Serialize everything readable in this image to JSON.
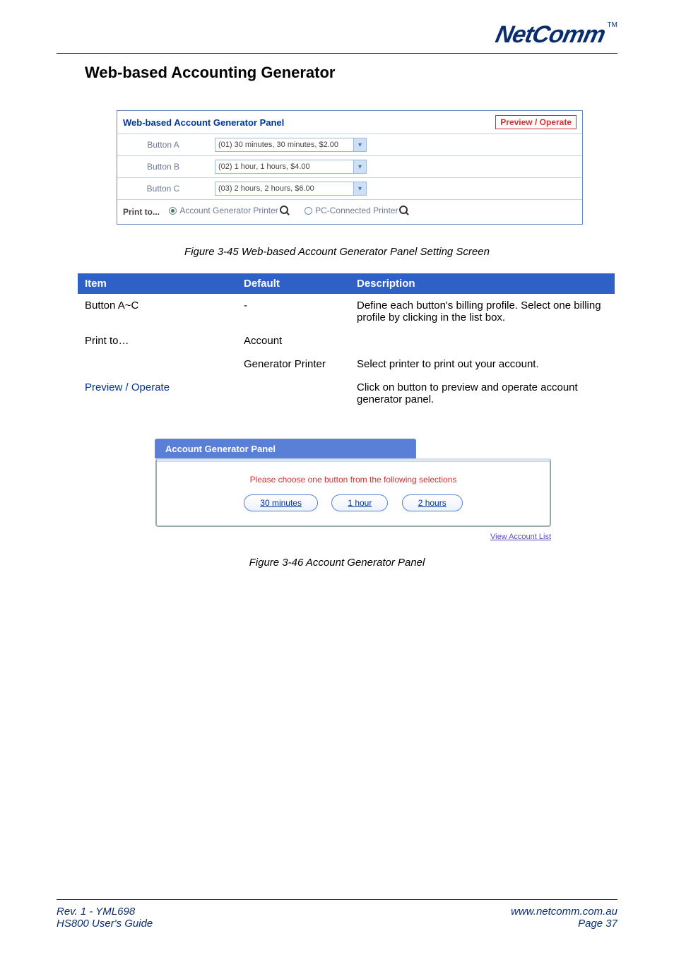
{
  "brand": {
    "name": "NetComm",
    "tm": "TM"
  },
  "title": "Web-based Accounting Generator",
  "ill1": {
    "title": "Web-based Account Generator Panel",
    "preview_btn": "Preview / Operate",
    "rows": [
      {
        "label": "Button A",
        "value": "(01) 30 minutes, 30 minutes, $2.00"
      },
      {
        "label": "Button B",
        "value": "(02) 1 hour, 1 hours, $4.00"
      },
      {
        "label": "Button C",
        "value": "(03) 2 hours, 2 hours, $6.00"
      }
    ],
    "print_to_label": "Print to...",
    "print_opts": {
      "acct": "Account Generator Printer",
      "pc": "PC-Connected Printer"
    }
  },
  "fig1_caption": "Figure 3-45 Web-based Account Generator Panel Setting Screen",
  "desc_table": {
    "headers": {
      "item": "Item",
      "default": "Default",
      "desc": "Description"
    },
    "rows": [
      {
        "item": "Button A~C",
        "def": "-",
        "desc": "Define each button's billing profile. Select one billing profile by clicking in the list box."
      },
      {
        "item": "Print to…",
        "def": "Account",
        "desc": ""
      },
      {
        "item": "",
        "def": "Generator Printer",
        "desc": "Select printer to print out your account."
      },
      {
        "item_link": "Preview / Operate",
        "def": "",
        "desc": "Click on button to preview and operate account generator panel."
      }
    ]
  },
  "ill2": {
    "tab": "Account Generator Panel",
    "msg": "Please choose one button from the following selections",
    "buttons": [
      "30 minutes",
      "1 hour",
      "2 hours"
    ],
    "view_list": "View Account List"
  },
  "fig2_caption": "Figure 3-46 Account Generator Panel",
  "footer": {
    "left1": "Rev. 1 - YML698",
    "left2": "HS800 User's Guide",
    "right1": "www.netcomm.com.au",
    "right2": "Page 37"
  }
}
